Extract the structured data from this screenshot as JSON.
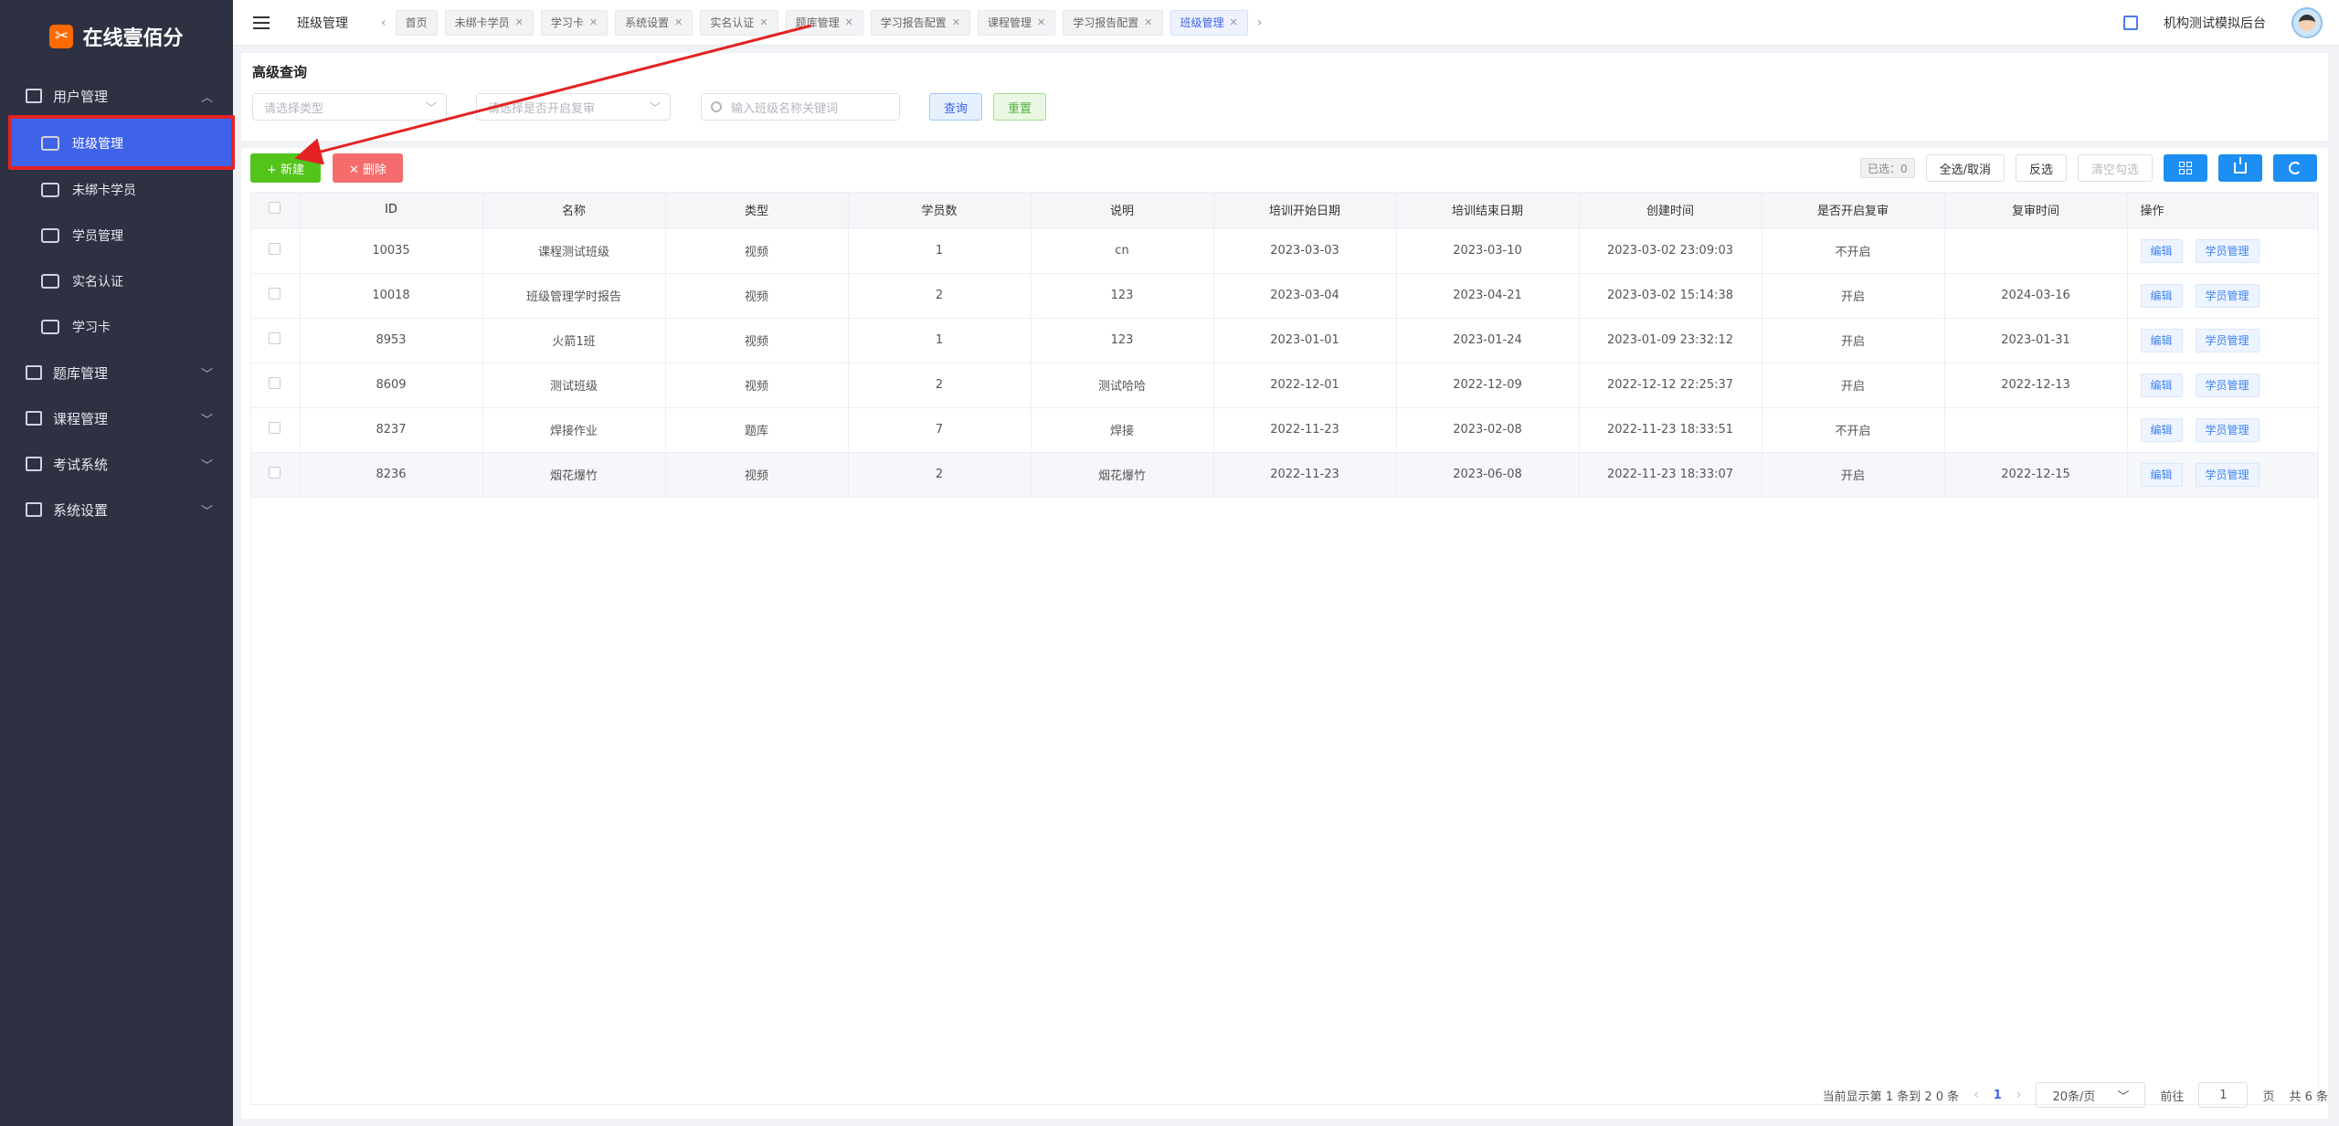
{
  "brand": {
    "name": "在线壹佰分",
    "logo_icon": "scissors-logo-icon"
  },
  "sidebar": {
    "items": [
      {
        "label": "用户管理",
        "expanded": true,
        "children": [
          {
            "label": "班级管理",
            "active": true
          },
          {
            "label": "未绑卡学员"
          },
          {
            "label": "学员管理"
          },
          {
            "label": "实名认证"
          },
          {
            "label": "学习卡"
          }
        ]
      },
      {
        "label": "题库管理"
      },
      {
        "label": "课程管理"
      },
      {
        "label": "考试系统"
      },
      {
        "label": "系统设置"
      }
    ]
  },
  "header": {
    "breadcrumb": "班级管理",
    "tabs": [
      {
        "label": "首页",
        "closable": false
      },
      {
        "label": "未绑卡学员"
      },
      {
        "label": "学习卡"
      },
      {
        "label": "系统设置"
      },
      {
        "label": "实名认证"
      },
      {
        "label": "题库管理"
      },
      {
        "label": "学习报告配置"
      },
      {
        "label": "课程管理"
      },
      {
        "label": "学习报告配置"
      },
      {
        "label": "班级管理",
        "active": true
      }
    ],
    "user_name": "机构测试模拟后台"
  },
  "search": {
    "title": "高级查询",
    "type_placeholder": "请选择类型",
    "review_placeholder": "请选择是否开启复审",
    "keyword_placeholder": "输入班级名称关键词",
    "query_label": "查询",
    "reset_label": "重置"
  },
  "toolbar": {
    "add_label": "+ 新建",
    "delete_label": "✕ 删除",
    "selected_label": "已选：0",
    "select_all_label": "全选/取消",
    "invert_label": "反选",
    "clear_label": "清空勾选"
  },
  "table": {
    "columns": [
      "ID",
      "名称",
      "类型",
      "学员数",
      "说明",
      "培训开始日期",
      "培训结束日期",
      "创建时间",
      "是否开启复审",
      "复审时间",
      "操作"
    ],
    "rows": [
      {
        "id": "10035",
        "name": "课程测试班级",
        "type": "视频",
        "count": "1",
        "desc": "cn",
        "start": "2023-03-03",
        "end": "2023-03-10",
        "created": "2023-03-02 23:09:03",
        "review": "不开启",
        "review_time": ""
      },
      {
        "id": "10018",
        "name": "班级管理学时报告",
        "type": "视频",
        "count": "2",
        "desc": "123",
        "start": "2023-03-04",
        "end": "2023-04-21",
        "created": "2023-03-02 15:14:38",
        "review": "开启",
        "review_time": "2024-03-16"
      },
      {
        "id": "8953",
        "name": "火箭1班",
        "type": "视频",
        "count": "1",
        "desc": "123",
        "start": "2023-01-01",
        "end": "2023-01-24",
        "created": "2023-01-09 23:32:12",
        "review": "开启",
        "review_time": "2023-01-31"
      },
      {
        "id": "8609",
        "name": "测试班级",
        "type": "视频",
        "count": "2",
        "desc": "测试哈哈",
        "start": "2022-12-01",
        "end": "2022-12-09",
        "created": "2022-12-12 22:25:37",
        "review": "开启",
        "review_time": "2022-12-13"
      },
      {
        "id": "8237",
        "name": "焊接作业",
        "type": "题库",
        "count": "7",
        "desc": "焊接",
        "start": "2022-11-23",
        "end": "2023-02-08",
        "created": "2022-11-23 18:33:51",
        "review": "不开启",
        "review_time": ""
      },
      {
        "id": "8236",
        "name": "烟花爆竹",
        "type": "视频",
        "count": "2",
        "desc": "烟花爆竹",
        "start": "2022-11-23",
        "end": "2023-06-08",
        "created": "2022-11-23 18:33:07",
        "review": "开启",
        "review_time": "2022-12-15"
      }
    ],
    "edit_label": "编辑",
    "students_label": "学员管理"
  },
  "pagination": {
    "summary": "当前显示第 1 条到 2 0 条",
    "current_page": "1",
    "page_size": "20条/页",
    "goto_label": "前往",
    "goto_value": "1",
    "page_unit": "页",
    "total": "共 6 条"
  },
  "colors": {
    "sidebar_bg": "#2d3142",
    "accent": "#3f63e8",
    "add": "#52c41a",
    "delete": "#f56c6c",
    "annotation": "#e32323"
  }
}
